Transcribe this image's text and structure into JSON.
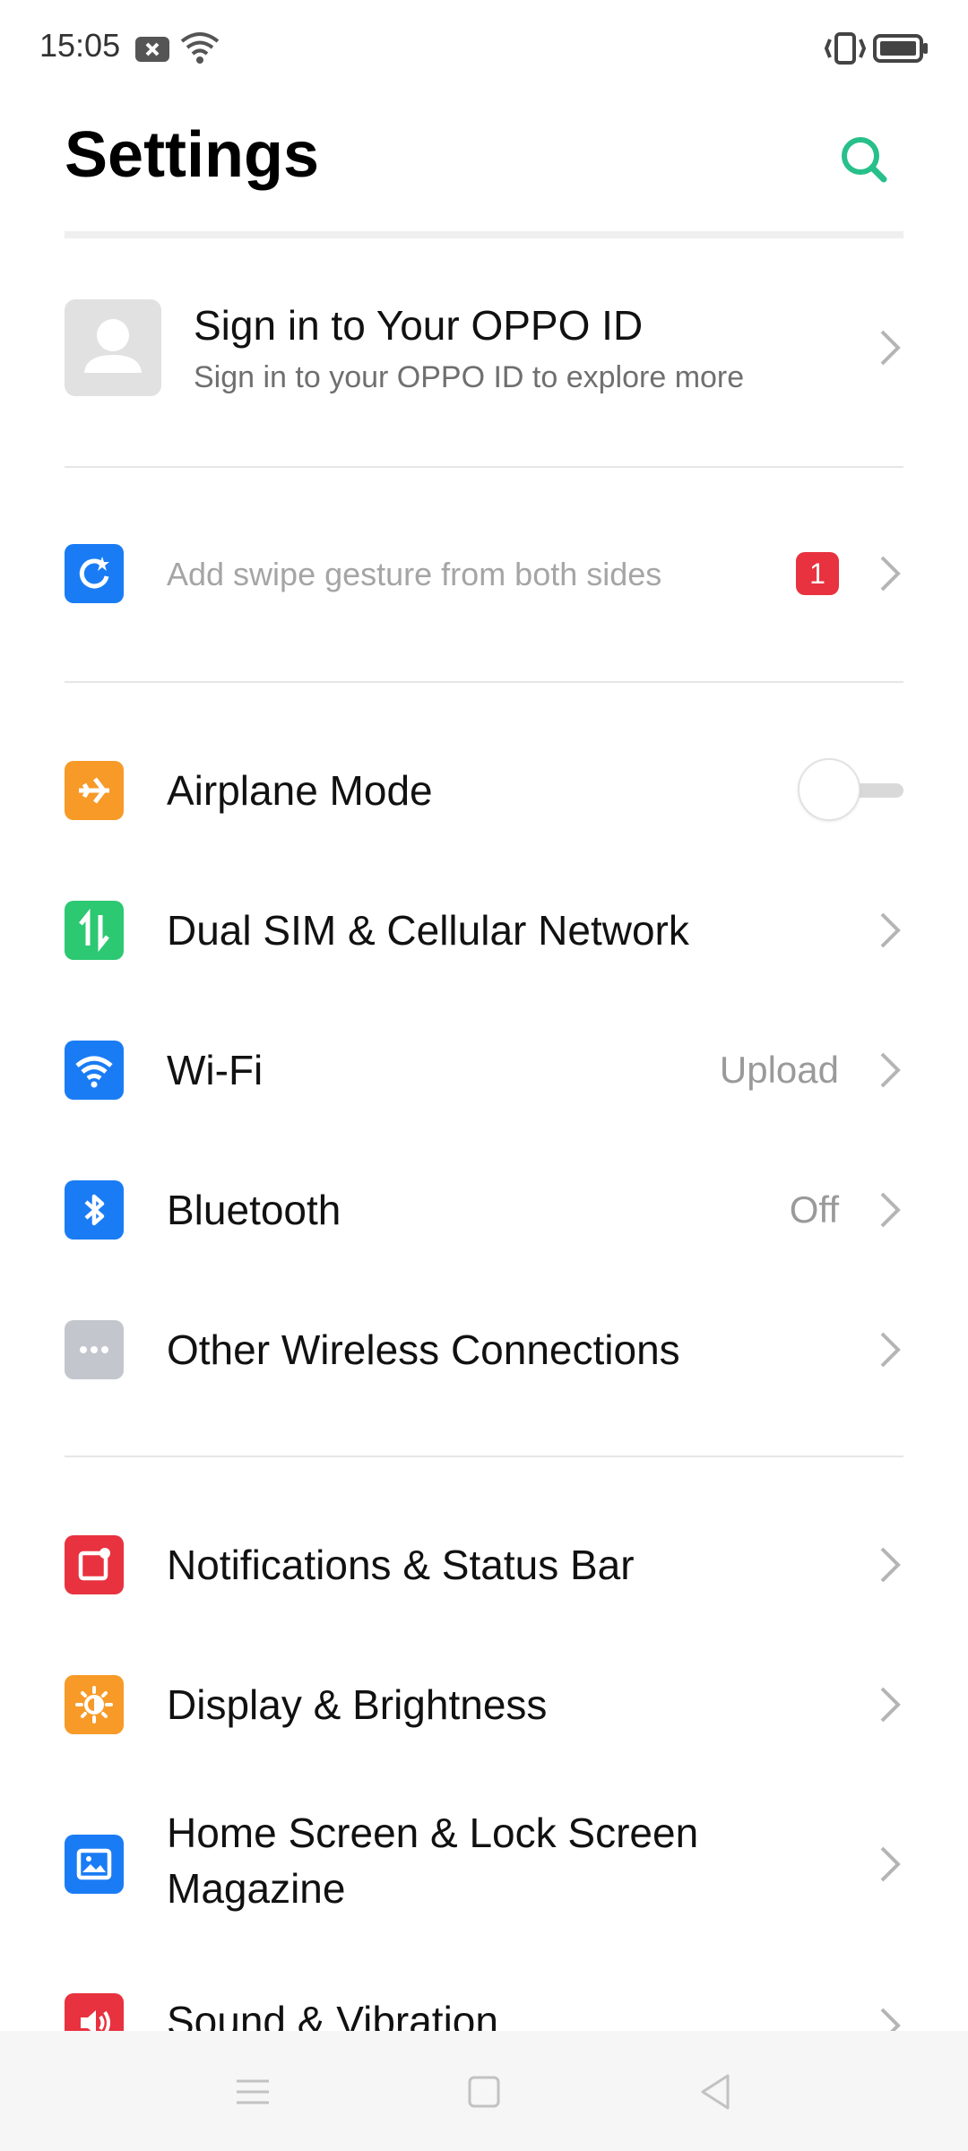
{
  "status_bar": {
    "time": "15:05",
    "icons": [
      "close-notification-icon",
      "wifi-icon",
      "vibrate-icon",
      "battery-icon"
    ]
  },
  "header": {
    "title": "Settings",
    "search_icon": "search-icon",
    "accent_color": "#27c08a"
  },
  "account": {
    "title": "Sign in to Your OPPO ID",
    "subtitle": "Sign in to your OPPO ID to explore more",
    "avatar_icon": "person-icon"
  },
  "suggestion": {
    "label": "Add swipe gesture from both sides",
    "badge": "1",
    "icon": "gesture-icon",
    "icon_color": "#1a7cf5"
  },
  "connectivity": [
    {
      "label": "Airplane Mode",
      "icon": "airplane-icon",
      "icon_color": "#f79a28",
      "toggle": "off"
    },
    {
      "label": "Dual SIM & Cellular Network",
      "icon": "cellular-icon",
      "icon_color": "#2cc872"
    },
    {
      "label": "Wi-Fi",
      "value": "Upload",
      "icon": "wifi-icon",
      "icon_color": "#1a7cf5"
    },
    {
      "label": "Bluetooth",
      "value": "Off",
      "icon": "bluetooth-icon",
      "icon_color": "#1a7cf5"
    },
    {
      "label": "Other Wireless Connections",
      "icon": "more-icon",
      "icon_color": "#c3c6cc"
    }
  ],
  "personalization": [
    {
      "label": "Notifications & Status Bar",
      "icon": "notification-icon",
      "icon_color": "#e8323f"
    },
    {
      "label": "Display & Brightness",
      "icon": "brightness-icon",
      "icon_color": "#f79a28"
    },
    {
      "label_line1": "Home Screen & Lock Screen",
      "label_line2": "Magazine",
      "icon": "wallpaper-icon",
      "icon_color": "#1a7cf5"
    },
    {
      "label": "Sound & Vibration",
      "icon": "sound-icon",
      "icon_color": "#e8323f"
    }
  ],
  "nav_bar": {
    "buttons": [
      "menu-icon",
      "home-icon",
      "back-icon"
    ]
  }
}
